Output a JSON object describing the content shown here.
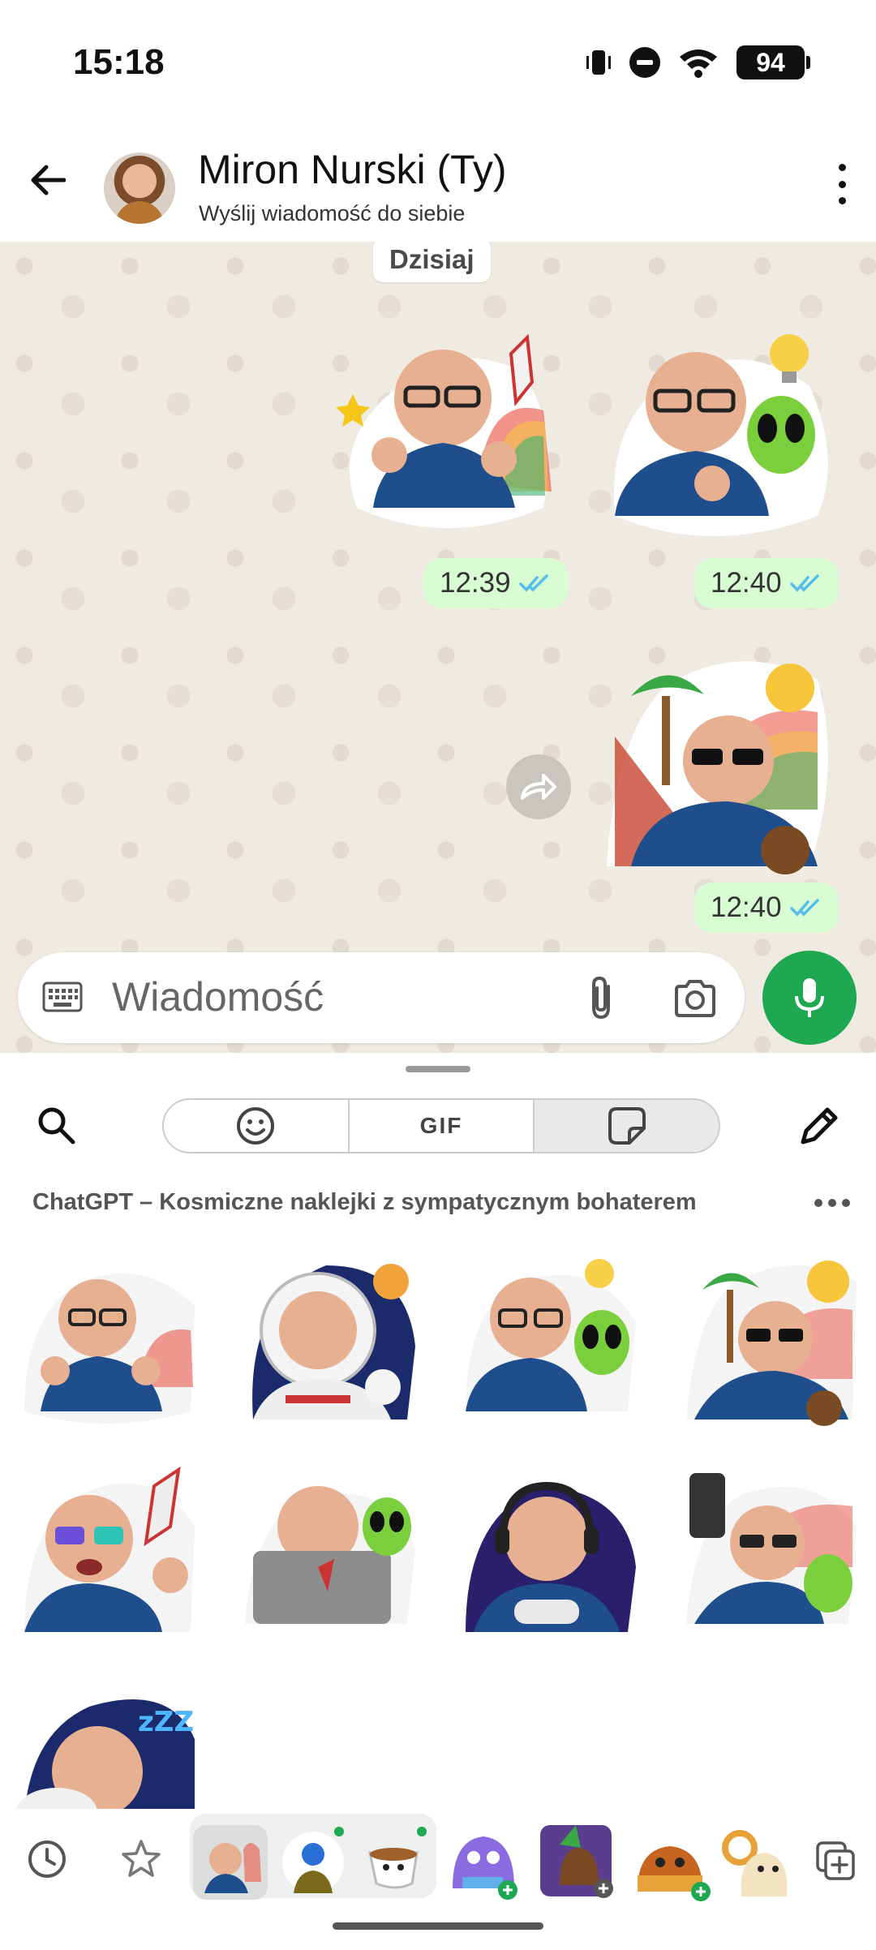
{
  "status_bar": {
    "time": "15:18",
    "battery": "94"
  },
  "header": {
    "name": "Miron Nurski (Ty)",
    "subtitle": "Wyślij wiadomość do siebie"
  },
  "chat": {
    "date_chip": "Dzisiaj",
    "messages": [
      {
        "type": "sticker",
        "sticker": "thumbs-up-rocket-rainbow",
        "time": "12:39",
        "status": "read"
      },
      {
        "type": "sticker",
        "sticker": "thinking-alien-lightbulb",
        "time": "12:40",
        "status": "read"
      },
      {
        "type": "sticker",
        "sticker": "relaxing-palm-sun-coconut",
        "time": "12:40",
        "status": "read"
      }
    ]
  },
  "composer": {
    "placeholder": "Wiadomość"
  },
  "sticker_panel": {
    "tabs": [
      "emoji",
      "GIF",
      "stickers"
    ],
    "gif_label": "GIF",
    "active_tab": "stickers",
    "pack_title": "ChatGPT – Kosmiczne naklejki z sympatycznym bohaterem",
    "stickers": [
      "thumbs-up-rocket-rainbow",
      "astronaut-wink-planet",
      "thinking-alien-lightbulb",
      "relaxing-palm-sun-coconut",
      "rainbow-glasses-rocket-cheer",
      "laptop-rocket-alien",
      "gamer-headphones-controller",
      "selfie-alien-rainbow",
      "sleeping-zzz-alien"
    ],
    "tray": [
      "recent-icon",
      "favorites-icon",
      "pack-chatgpt-space",
      "pack-avatar",
      "pack-coffee-cup",
      "pack-purple-monster",
      "pack-beaver-party",
      "pack-beaver-orange",
      "pack-ram-character",
      "add-pack-icon"
    ]
  },
  "colors": {
    "accent_green": "#1da851",
    "bubble_green": "#d9fdd3",
    "tick_blue": "#53bdeb",
    "chat_bg": "#efeae2"
  }
}
